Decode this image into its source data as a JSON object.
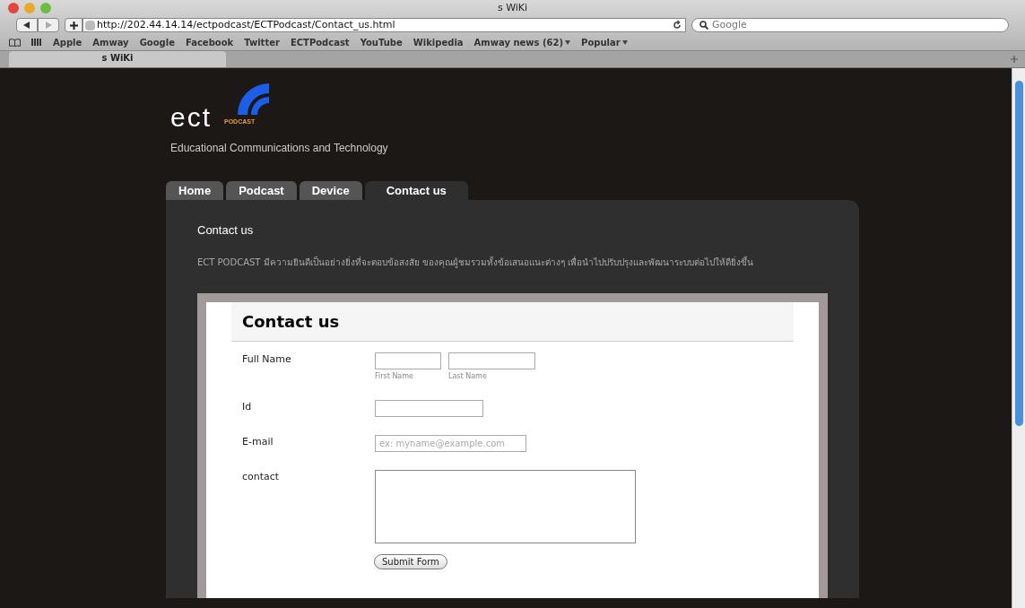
{
  "window": {
    "title": "s WiKi"
  },
  "toolbar": {
    "url": "http://202.44.14.14/ectpodcast/ECTPodcast/Contact_us.html",
    "search_placeholder": "Google"
  },
  "bookmarks": [
    {
      "label": "Apple",
      "kind": "link"
    },
    {
      "label": "Amway",
      "kind": "link"
    },
    {
      "label": "Google",
      "kind": "link"
    },
    {
      "label": "Facebook",
      "kind": "link"
    },
    {
      "label": "Twitter",
      "kind": "link"
    },
    {
      "label": "ECTPodcast",
      "kind": "link"
    },
    {
      "label": "YouTube",
      "kind": "link"
    },
    {
      "label": "Wikipedia",
      "kind": "link"
    },
    {
      "label": "Amway news (62)",
      "kind": "menu"
    },
    {
      "label": "Popular",
      "kind": "menu"
    }
  ],
  "browser_tabs": [
    {
      "label": "s WiKi",
      "selected": true
    }
  ],
  "site": {
    "logo_text": "ect",
    "logo_sub": "PODCAST",
    "tagline": "Educational Communications and Technology",
    "nav": [
      {
        "label": "Home",
        "selected": false
      },
      {
        "label": "Podcast",
        "selected": false
      },
      {
        "label": "Device",
        "selected": false
      },
      {
        "label": "Contact us",
        "selected": true
      }
    ],
    "heading": "Contact us",
    "intro": "ECT PODCAST มีความยินดีเป็นอย่างยิ่งที่จะตอบข้อสงสัย ของคุณผู้ชมรวมทั้งข้อเสนอแนะต่างๆ เพื่อนำไปปรับปรุงและพัฒนาระบบต่อไปให้ดียิ่งขึ้น"
  },
  "form": {
    "title": "Contact us",
    "fields": [
      {
        "label": "Full Name",
        "kind": "name",
        "sublabels": [
          "First Name",
          "Last Name"
        ]
      },
      {
        "label": "Id",
        "kind": "text"
      },
      {
        "label": "E-mail",
        "kind": "email",
        "placeholder": "ex: myname@example.com"
      },
      {
        "label": "contact",
        "kind": "textarea"
      }
    ],
    "submit": "Submit Form"
  }
}
